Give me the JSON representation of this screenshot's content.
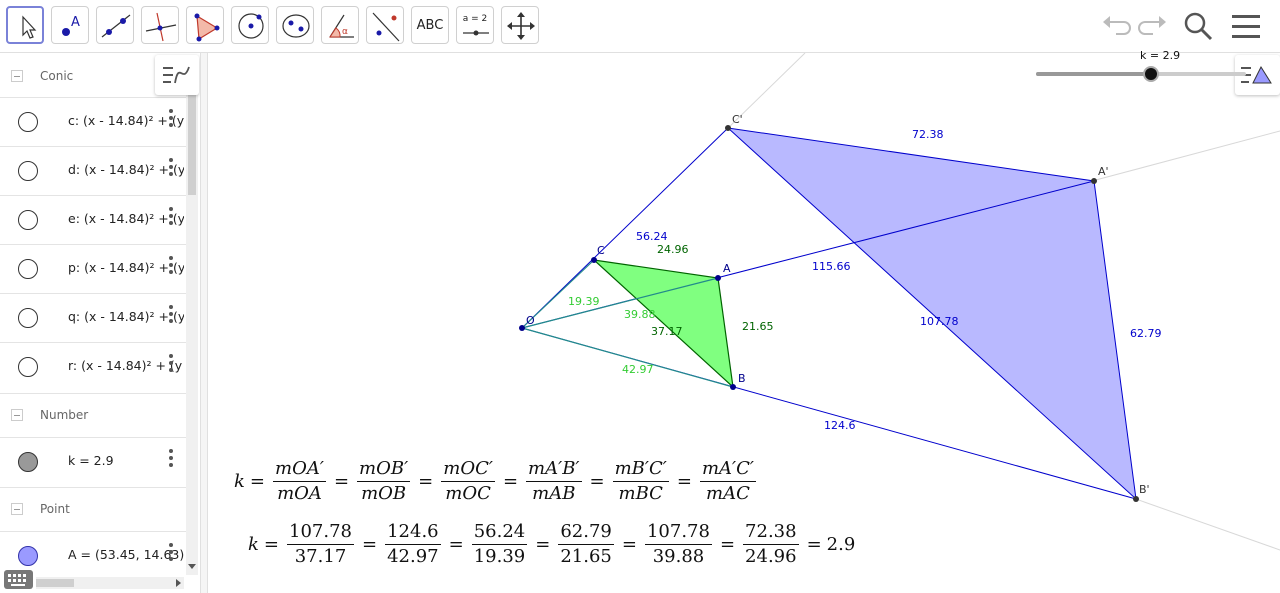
{
  "toolbar": {
    "tools": [
      {
        "name": "move-tool",
        "text": ""
      },
      {
        "name": "point-tool",
        "text": "A"
      },
      {
        "name": "line-tool",
        "text": ""
      },
      {
        "name": "perpendicular-tool",
        "text": ""
      },
      {
        "name": "polygon-tool",
        "text": ""
      },
      {
        "name": "circle-tool",
        "text": ""
      },
      {
        "name": "ellipse-tool",
        "text": ""
      },
      {
        "name": "angle-tool",
        "text": "α"
      },
      {
        "name": "reflect-tool",
        "text": ""
      },
      {
        "name": "text-tool",
        "text": "ABC"
      },
      {
        "name": "slider-tool",
        "text": "a = 2"
      },
      {
        "name": "move-graphics-tool",
        "text": ""
      }
    ],
    "right": [
      "undo-icon",
      "redo-icon",
      "search-icon",
      "menu-icon"
    ]
  },
  "algebra": {
    "groups": [
      {
        "label": "Conic"
      },
      {
        "label": "Number"
      },
      {
        "label": "Point"
      }
    ],
    "conics": [
      "c: (x - 14.84)² + (y",
      "d: (x - 14.84)² + (y",
      "e: (x - 14.84)² + (y",
      "p: (x - 14.84)² + (y",
      "q: (x - 14.84)² + (y",
      "r: (x - 14.84)² + (y"
    ],
    "number": "k = 2.9",
    "point": "A = (53.45, 14.63)",
    "colors": {
      "number_fill": "#999999",
      "point_fill": "#9a9aff"
    }
  },
  "graphics": {
    "slider_label": "k = 2.9",
    "slider_value": 2.9,
    "points": {
      "O": "O",
      "A": "A",
      "B": "B",
      "C": "C",
      "A1": "A'",
      "B1": "B'",
      "C1": "C'"
    },
    "labels": {
      "OC1": "56.24",
      "C1A1": "72.38",
      "OA1": "115.66",
      "C1B1": "107.78",
      "A1B1": "62.79",
      "OB1": "124.6",
      "CA": "24.96",
      "AB": "21.65",
      "OC": "19.39",
      "BC_in": "39.88",
      "OA_in": "37.17",
      "OB": "42.97"
    },
    "colors": {
      "small_triangle": "#80ff80",
      "big_triangle": "#b9b9ff",
      "blue": "#0000cc",
      "dark_green": "#006400",
      "light_green": "#33cc33"
    },
    "formula1": {
      "lhs": "k",
      "fracs": [
        [
          "mOA′",
          "mOA"
        ],
        [
          "mOB′",
          "mOB"
        ],
        [
          "mOC′",
          "mOC"
        ],
        [
          "mA′B′",
          "mAB"
        ],
        [
          "mB′C′",
          "mBC"
        ],
        [
          "mA′C′",
          "mAC"
        ]
      ]
    },
    "formula2": {
      "lhs": "k",
      "fracs": [
        [
          "107.78",
          "37.17"
        ],
        [
          "124.6",
          "42.97"
        ],
        [
          "56.24",
          "19.39"
        ],
        [
          "62.79",
          "21.65"
        ],
        [
          "107.78",
          "39.88"
        ],
        [
          "72.38",
          "24.96"
        ]
      ],
      "result": "2.9"
    }
  }
}
